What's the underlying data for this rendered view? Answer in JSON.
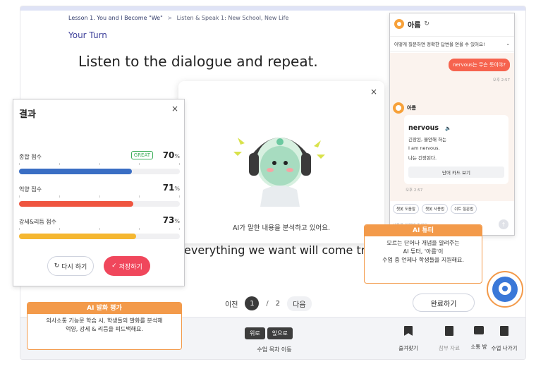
{
  "lesson": {
    "breadcrumb_lesson": "Lesson 1.  You and I Become \"We\"",
    "breadcrumb_sub": "Listen & Speak 1: New School, New Life",
    "your_turn": "Your Turn",
    "instruction": "Listen to the dialogue and repeat.",
    "dialogue_line": "everything we want will come true."
  },
  "analyze_modal": {
    "close": "×",
    "message": "AI가 말한 내용을 분석하고 있어요."
  },
  "result_panel": {
    "title": "결과",
    "close": "×",
    "metrics": [
      {
        "label": "종합 점수",
        "value": "70",
        "unit": "%",
        "badge": "GREAT",
        "percent": 70,
        "color": "#3a6ec4"
      },
      {
        "label": "억양 점수",
        "value": "71",
        "unit": "%",
        "percent": 71,
        "color": "#ef5540"
      },
      {
        "label": "강세&리듬 점수",
        "value": "73",
        "unit": "%",
        "percent": 73,
        "color": "#f5b731"
      }
    ],
    "retry_label": "다시 하기",
    "save_label": "저장하기"
  },
  "pager": {
    "prev": "이전",
    "current": "1",
    "slash": "/",
    "total": "2",
    "next": "다음"
  },
  "complete_label": "완료하기",
  "bottom_bar": {
    "nav_up": "위로",
    "nav_down": "앞으로",
    "nav_label": "수업 목차 이동",
    "tools": [
      {
        "label": "즐겨찾기",
        "icon": "bookmark-icon"
      },
      {
        "label": "참부 자료",
        "icon": "attachment-icon"
      },
      {
        "label": "소통 방",
        "icon": "chat-room-icon"
      },
      {
        "label": "수업 나가기",
        "icon": "exit-icon"
      }
    ]
  },
  "chat": {
    "name": "아름",
    "refresh": "↻",
    "subhead": "어떻게 질문하면 정확한 답변을 얻을 수 있어요!",
    "user_message": "nervous는 무슨 뜻이야?",
    "user_time": "오후 2:57",
    "bot_name": "아름",
    "bot_word": "nervous",
    "bot_speaker": "🔈",
    "bot_meaning": "긴장된, 불안해 하는",
    "bot_example_en": "I am nervous.",
    "bot_example_ko": "나는 긴장된다.",
    "bot_card_button": "단어 카드 보기",
    "bot_time": "오후 2:57",
    "chips": [
      "챗봇 도움말",
      "챗봇 사용법",
      "쉬트 질문법"
    ],
    "input_placeholder": "내용을 입력해 주세요",
    "send": "↑"
  },
  "callout_ai_tutor": {
    "title": "AI 튜터",
    "line1": "모르는 단어나 개념을 알려주는",
    "line2": "AI 튜터, '아름'이",
    "line3": "수업 중 언제나 학생들을 지원해요."
  },
  "callout_ai_speech": {
    "title": "AI 발화 평가",
    "line1": "의사소통 기능문 학습 시, 학생들의 발화를 분석해",
    "line2": "억양, 강세 & 리듬을 피드백해요."
  },
  "colors": {
    "accent_orange": "#f39a4a",
    "save_red": "#f0475c",
    "fab_blue": "#3a78d8"
  }
}
